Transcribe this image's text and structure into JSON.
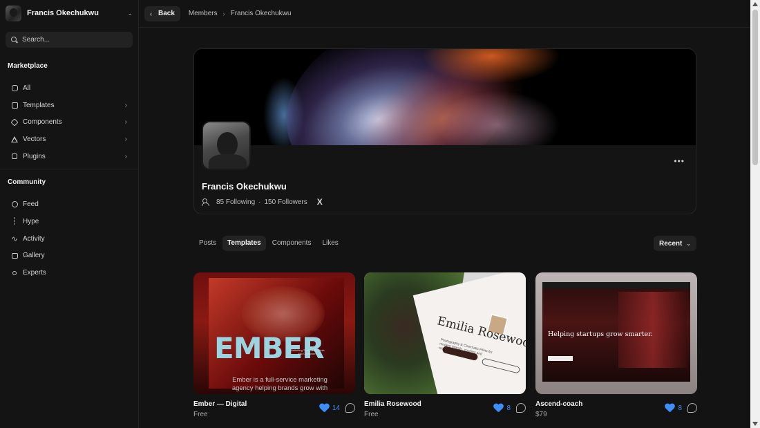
{
  "sidebar": {
    "user_name": "Francis Okechukwu",
    "search_placeholder": "Search...",
    "marketplace_title": "Marketplace",
    "marketplace_items": [
      {
        "label": "All",
        "icon": "all-icon"
      },
      {
        "label": "Templates",
        "icon": "templates-icon"
      },
      {
        "label": "Components",
        "icon": "components-icon"
      },
      {
        "label": "Vectors",
        "icon": "vectors-icon"
      },
      {
        "label": "Plugins",
        "icon": "plugins-icon"
      }
    ],
    "community_title": "Community",
    "community_items": [
      {
        "label": "Feed",
        "icon": "feed-icon"
      },
      {
        "label": "Hype",
        "icon": "hype-icon"
      },
      {
        "label": "Activity",
        "icon": "activity-icon"
      },
      {
        "label": "Gallery",
        "icon": "gallery-icon"
      },
      {
        "label": "Experts",
        "icon": "experts-icon"
      }
    ]
  },
  "topbar": {
    "back_label": "Back",
    "breadcrumb": [
      "Members",
      "Francis Okechukwu"
    ]
  },
  "profile": {
    "name": "Francis Okechukwu",
    "following": "85 Following",
    "followers": "150 Followers",
    "social": "X"
  },
  "tabs": [
    "Posts",
    "Templates",
    "Components",
    "Likes"
  ],
  "active_tab": "Templates",
  "sort_label": "Recent",
  "cards": [
    {
      "title": "Ember — Digital",
      "price": "Free",
      "likes": "14",
      "thumb_word": "EMBER",
      "thumb_sub": "Ember is a full-service marketing agency helping brands grow with",
      "thumb_tiny": "Marketing That Turns Clicks Into Customers"
    },
    {
      "title": "Emilia Rosewood",
      "price": "Free",
      "likes": "8",
      "thumb_word": "Emilia Rosewood",
      "thumb_sub": "Photography & Cinematic Films for modern brands, couples and creatives"
    },
    {
      "title": "Ascend-coach",
      "price": "$79",
      "likes": "8",
      "thumb_word": "Helping startups grow smarter."
    }
  ],
  "colors": {
    "background": "#131313",
    "accent_like": "#3e8ef7"
  }
}
